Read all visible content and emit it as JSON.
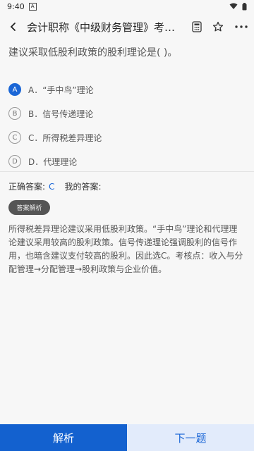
{
  "status_bar": {
    "time": "9:40",
    "notif_glyph": "A"
  },
  "header": {
    "title": "会计职称《中级财务管理》考前必…",
    "icons": [
      "back-arrow-icon",
      "calculator-icon",
      "star-icon",
      "more-icon"
    ]
  },
  "question": {
    "text": "建议采取低股利政策的股利理论是(    )。"
  },
  "options": [
    {
      "letter": "A",
      "label": "A．“手中鸟”理论",
      "selected": true
    },
    {
      "letter": "B",
      "label": "B．信号传递理论",
      "selected": false
    },
    {
      "letter": "C",
      "label": "C．所得税差异理论",
      "selected": false
    },
    {
      "letter": "D",
      "label": "D．代理理论",
      "selected": false
    }
  ],
  "answer": {
    "correct_label": "正确答案:",
    "correct_value": "C",
    "my_label": "我的答案:"
  },
  "analysis_badge": "答案解析",
  "explanation": "所得税差异理论建议采用低股利政策。“手中鸟”理论和代理理论建议采用较高的股利政策。信号传递理论强调股利的信号作用，也暗含建议支付较高的股利。因此选C。考核点：收入与分配管理→分配管理→股利政策与企业价值。",
  "bottom": {
    "analyze_label": "解析",
    "next_label": "下一题"
  },
  "colors": {
    "accent": "#1a66d6",
    "button_primary": "#1361cf",
    "button_secondary": "#e2ebfb"
  }
}
